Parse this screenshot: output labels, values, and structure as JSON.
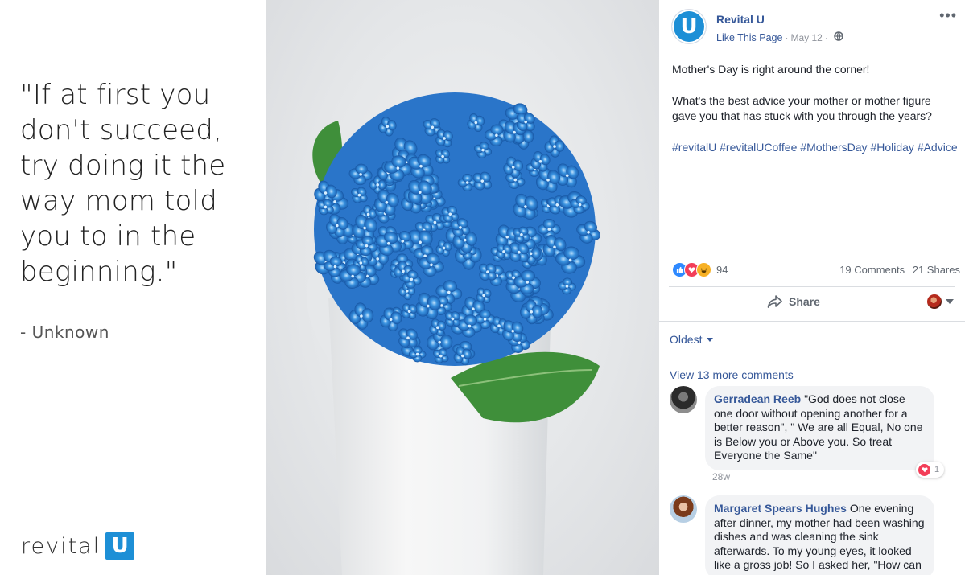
{
  "quote": {
    "text": "\"If at first you don't succeed, try doing it the way mom told you to in the beginning.\"",
    "author": "- Unknown"
  },
  "brand": {
    "word": "revital",
    "letter": "U",
    "accent_color": "#1d8fd6"
  },
  "photo": {
    "subject": "blue-hydrangea-in-white-mug",
    "flower_color": "#2f86d6",
    "leaf_color": "#3d8b3a"
  },
  "post": {
    "page_avatar_letter": "U",
    "page_name": "Revital U",
    "like_page": "Like This Page",
    "separator": "·",
    "date": "May 12",
    "more_icon": "ellipsis-icon",
    "body_line1": "Mother's Day is right around the corner!",
    "body_line2": "What's the best advice your mother or mother figure gave you that has stuck with you through the years?",
    "hashtags": [
      "#revitalU",
      "#revitalUCoffee",
      "#MothersDay",
      "#Holiday",
      "#Advice"
    ],
    "reaction_count": "94",
    "comments_count": "19 Comments",
    "shares_count": "21 Shares",
    "share_label": "Share",
    "sort_label": "Oldest",
    "view_more": "View 13 more comments"
  },
  "comments": [
    {
      "author": "Gerradean Reeb",
      "text": "\"God does not close one door without opening another for a better reason\", \" We are all Equal, No one is Below you or Above you. So treat Everyone the Same\"",
      "time": "28w",
      "reaction_count": "1"
    },
    {
      "author": "Margaret Spears Hughes",
      "text": "One evening after dinner, my mother had been washing dishes and was cleaning the sink afterwards. To my young eyes, it looked like a gross job! So I asked her, \"How can"
    }
  ]
}
